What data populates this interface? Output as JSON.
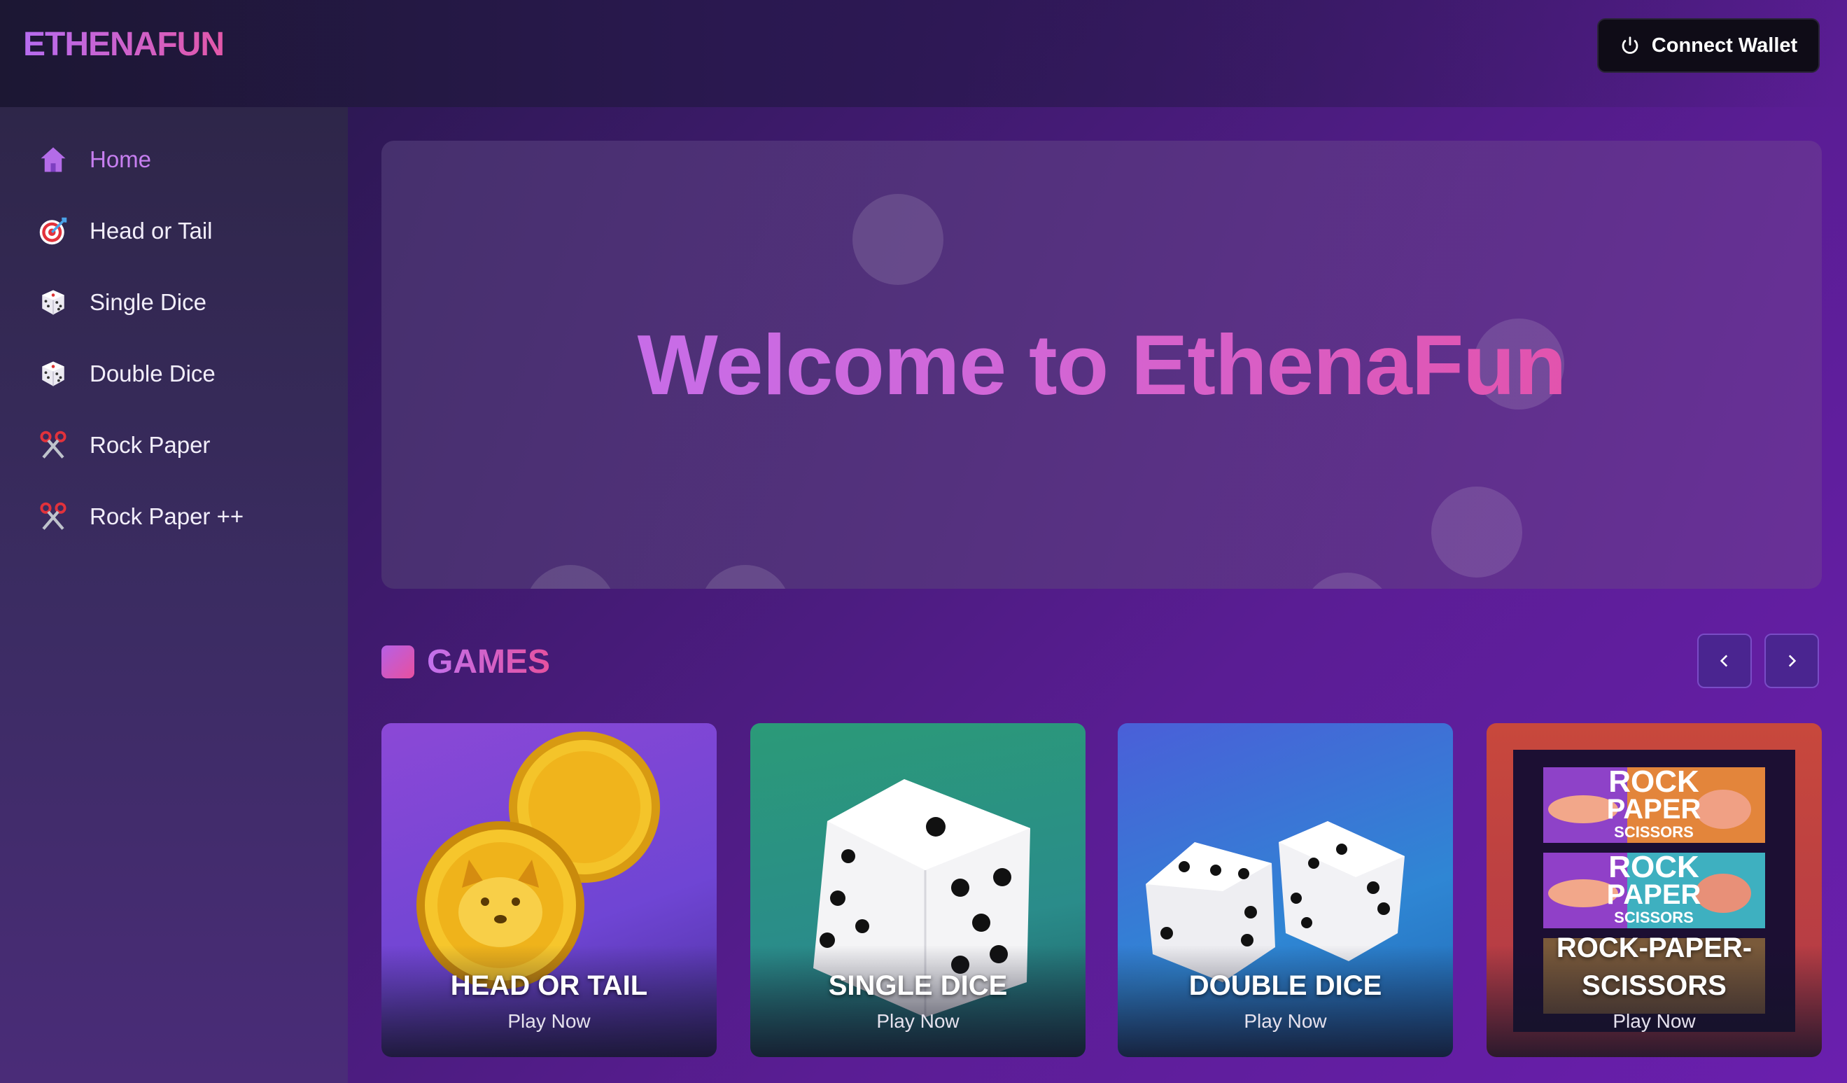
{
  "header": {
    "logo": "ETHENAFUN",
    "connect_label": "Connect Wallet"
  },
  "sidebar": {
    "items": [
      {
        "label": "Home",
        "icon": "home-icon",
        "active": true
      },
      {
        "label": "Head or Tail",
        "icon": "target-icon"
      },
      {
        "label": "Single Dice",
        "icon": "dice-icon"
      },
      {
        "label": "Double Dice",
        "icon": "dice-icon"
      },
      {
        "label": "Rock Paper",
        "icon": "scissors-icon"
      },
      {
        "label": "Rock Paper ++",
        "icon": "scissors-icon"
      }
    ]
  },
  "hero": {
    "title_part1": "Welcome to ",
    "title_part2": "EthenaFun"
  },
  "games": {
    "title": "GAMES",
    "cards": [
      {
        "title": "HEAD OR TAIL",
        "cta": "Play Now"
      },
      {
        "title": "SINGLE DICE",
        "cta": "Play Now"
      },
      {
        "title": "DOUBLE DICE",
        "cta": "Play Now"
      },
      {
        "title": "ROCK-PAPER-SCISSORS",
        "cta": "Play Now",
        "art_text": [
          "ROCK",
          "PAPER",
          "SCISSORS"
        ]
      }
    ]
  },
  "colors": {
    "accent_purple": "#c071f3",
    "accent_pink": "#ea4a9a"
  }
}
